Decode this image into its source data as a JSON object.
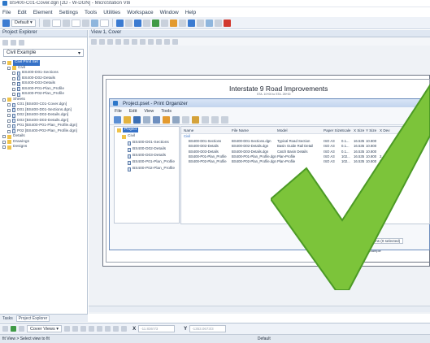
{
  "window": {
    "title": "BS400-C01-Cover.dgn [2D - W-DGN] - MicroStation V8i"
  },
  "menu": [
    "File",
    "Edit",
    "Element",
    "Settings",
    "Tools",
    "Utilities",
    "Workspace",
    "Window",
    "Help"
  ],
  "toolbar": {
    "level": "Default"
  },
  "panel": {
    "title": "Project Explorer",
    "workspace": "Civil Example",
    "tree": [
      {
        "label": "Civil Print Set",
        "selected": true,
        "indent": 1,
        "kind": "folder"
      },
      {
        "label": "Civil",
        "indent": 2,
        "kind": "folder"
      },
      {
        "label": "BS400-D01-Sections",
        "indent": 3,
        "kind": "doc"
      },
      {
        "label": "BS400-D02-Details",
        "indent": 3,
        "kind": "doc"
      },
      {
        "label": "BS400-D03-Details",
        "indent": 3,
        "kind": "doc"
      },
      {
        "label": "BS400-P01-Plan_Profile",
        "indent": 3,
        "kind": "doc"
      },
      {
        "label": "BS400-P02-Plan_Profile",
        "indent": 3,
        "kind": "doc"
      },
      {
        "label": "Sheets",
        "indent": 1,
        "kind": "folder"
      },
      {
        "label": "C01 [BS400-C01-Cover.dgn]",
        "indent": 2,
        "kind": "doc"
      },
      {
        "label": "D01 [BS400-D01-Sections.dgn]",
        "indent": 2,
        "kind": "doc"
      },
      {
        "label": "D02 [BS400-D02-Details.dgn]",
        "indent": 2,
        "kind": "doc"
      },
      {
        "label": "D03 [BS400-D03-Details.dgn]",
        "indent": 2,
        "kind": "doc"
      },
      {
        "label": "P01 [BS400-P01-Plan_Profile.dgn]",
        "indent": 2,
        "kind": "doc"
      },
      {
        "label": "P02 [BS400-P02-Plan_Profile.dgn]",
        "indent": 2,
        "kind": "doc"
      },
      {
        "label": "Details",
        "indent": 1,
        "kind": "folder"
      },
      {
        "label": "Drawings",
        "indent": 1,
        "kind": "folder"
      },
      {
        "label": "Designs",
        "indent": 1,
        "kind": "folder"
      }
    ],
    "tabs": [
      "Tasks",
      "Project Explorer"
    ]
  },
  "view": {
    "title": "View 1, Cover"
  },
  "sheet": {
    "title": "Interstate 9 Road Improvements",
    "subtitle": "STA. 10+00 to STA. 28+00",
    "client": "Bentley Civil Example"
  },
  "dialog": {
    "title": "Project.pset - Print Organizer",
    "menu": [
      "File",
      "Edit",
      "View",
      "Tools"
    ],
    "tree": [
      "Project",
      "Civil",
      "BS400-D01-Sections",
      "BS400-D02-Details",
      "BS400-D03-Details",
      "BS400-P01-Plan_Profile",
      "BS400-P02-Plan_Profile"
    ],
    "columns": [
      "Name",
      "File Name",
      "Model",
      "Paper Size",
      "Scale",
      "X Size",
      "Y Size",
      "X Dev"
    ],
    "group": "Civil",
    "rows": [
      [
        "BS400-D01-Sections",
        "BS400-D01-Sections.dgn",
        "Typical Road Section",
        "ISO A3",
        "0.1...",
        "16.535",
        "10.800",
        ""
      ],
      [
        "BS400-D02-Details",
        "BS400-D02-Details.dgn",
        "Basin Guide Rail Detail",
        "ISO A3",
        "0.1...",
        "16.535",
        "10.800",
        ""
      ],
      [
        "BS400-D03-Details",
        "BS400-D03-Details.dgn",
        "Catch Basin Details",
        "ISO A3",
        "0.1...",
        "16.535",
        "10.800",
        ""
      ],
      [
        "BS400-P01-Plan_Profile",
        "BS400-P01-Plan_Profile.dgn",
        "Plan-Profile",
        "ISO A3",
        "102...",
        "16.535",
        "10.800",
        "2.497"
      ],
      [
        "BS400-P02-Plan_Profile",
        "BS400-P02-Plan_Profile.dgn",
        "Plan-Profile",
        "ISO A3",
        "102...",
        "16.535",
        "10.800",
        "2.497"
      ]
    ],
    "status": "pdf.pltcfg  5 Items (0 selected)"
  },
  "bottom": {
    "view": "Cover Views",
    "x_label": "X",
    "x_value": "-11.8367/3",
    "y_label": "Y",
    "y_value": "-1353.0673/3"
  },
  "statusbar": {
    "left": "fit View > Select view to fit",
    "level": "Default"
  },
  "colors": {
    "check": "#7cc43a",
    "checkDark": "#4c9a25",
    "accent": "#3571c7"
  }
}
